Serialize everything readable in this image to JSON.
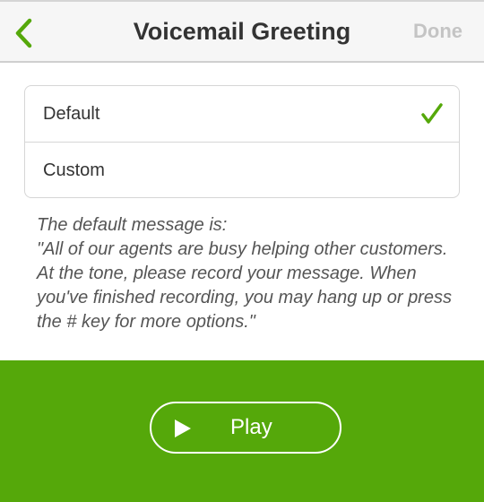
{
  "navbar": {
    "back_icon": "chevron-left-icon",
    "title": "Voicemail Greeting",
    "done_label": "Done"
  },
  "options": [
    {
      "label": "Default",
      "selected": true
    },
    {
      "label": "Custom",
      "selected": false
    }
  ],
  "description": {
    "line1": "The default message is:",
    "line2": "\"All of our agents are busy helping other customers. At the tone, please record your message. When you've finished recording, you may hang up or press the # key for more options.\""
  },
  "player": {
    "play_icon": "play-icon",
    "play_label": "Play"
  },
  "colors": {
    "accent_green": "#55a80a",
    "nav_background": "#f6f6f6",
    "disabled_text": "#c4c4c4"
  }
}
